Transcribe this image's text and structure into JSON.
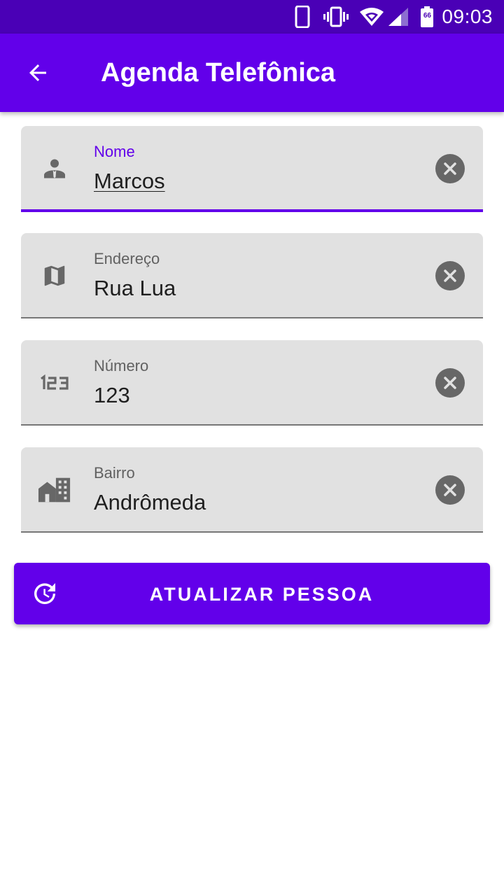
{
  "status_bar": {
    "time": "09:03",
    "battery_level": "66",
    "icons": [
      "phone-icon",
      "vibrate-icon",
      "wifi-icon",
      "signal-icon",
      "battery-icon"
    ]
  },
  "app_bar": {
    "title": "Agenda Telefônica",
    "back_icon": "arrow-back-icon",
    "background_color": "#6200ea"
  },
  "form": {
    "fields": [
      {
        "label": "Nome",
        "value": "Marcos",
        "icon": "person-icon",
        "focused": true
      },
      {
        "label": "Endereço",
        "value": "Rua Lua",
        "icon": "map-icon",
        "focused": false
      },
      {
        "label": "Número",
        "value": "123",
        "icon": "numbers-icon",
        "focused": false
      },
      {
        "label": "Bairro",
        "value": "Andrômeda",
        "icon": "location-city-icon",
        "focused": false
      }
    ],
    "clear_icon": "cancel-icon"
  },
  "action_button": {
    "label": "ATUALIZAR PESSOA",
    "icon": "update-icon"
  },
  "colors": {
    "primary": "#6200ea",
    "status_bar": "#4a00b6",
    "field_background": "#e1e1e1",
    "icon_gray": "#676767"
  }
}
